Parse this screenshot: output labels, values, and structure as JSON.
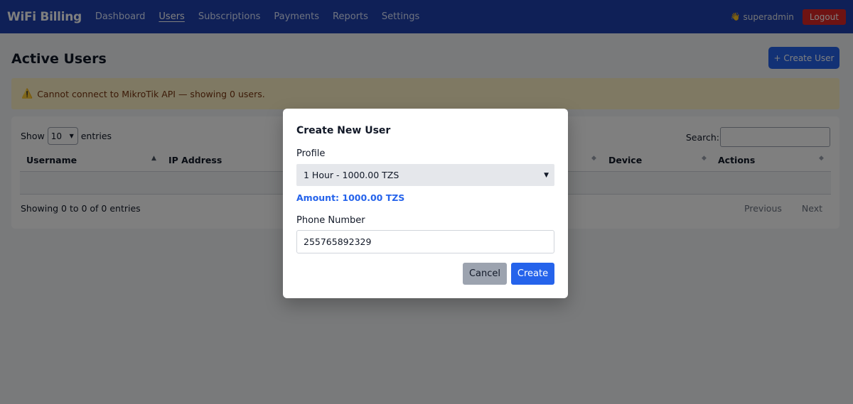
{
  "navbar": {
    "brand": "WiFi Billing",
    "links": [
      "Dashboard",
      "Users",
      "Subscriptions",
      "Payments",
      "Reports",
      "Settings"
    ],
    "active_link": "Users",
    "user": "superadmin",
    "logout_label": "Logout"
  },
  "page": {
    "title": "Active Users",
    "create_button": "+ Create User"
  },
  "alert": {
    "icon": "⚠️",
    "message": "Cannot connect to MikroTik API — showing 0 users."
  },
  "table": {
    "show_label": "Show",
    "entries_label": "entries",
    "page_length": "10",
    "search_label": "Search:",
    "columns": [
      "Username",
      "IP Address",
      "Device",
      "Actions"
    ],
    "info": "Showing 0 to 0 of 0 entries",
    "previous_label": "Previous",
    "next_label": "Next"
  },
  "modal": {
    "title": "Create New User",
    "profile_label": "Profile",
    "profile_value": "1 Hour - 1000.00 TZS",
    "amount_text": "Amount: 1000.00 TZS",
    "phone_label": "Phone Number",
    "phone_value": "255765892329",
    "cancel_label": "Cancel",
    "create_label": "Create"
  },
  "colors": {
    "navbar": "#1e40af",
    "primary": "#2563eb",
    "danger": "#dc2626",
    "alert_bg": "#fef3c7"
  }
}
